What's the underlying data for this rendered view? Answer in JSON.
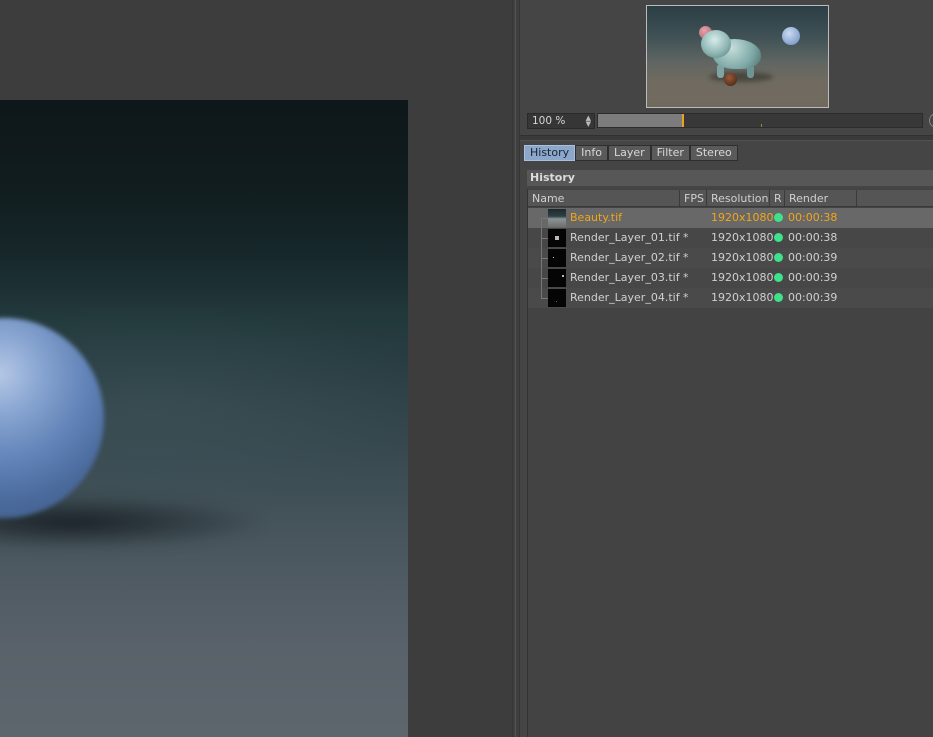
{
  "viewport": {
    "image_label": "rendered image (blue sphere, close-up)"
  },
  "navigator": {
    "thumbnail_label": "render preview thumbnail",
    "zoom_value": "100 %",
    "zoom_slider_fraction": 0.26
  },
  "tabs": [
    {
      "label": "History",
      "active": true
    },
    {
      "label": "Info",
      "active": false
    },
    {
      "label": "Layer",
      "active": false
    },
    {
      "label": "Filter",
      "active": false
    },
    {
      "label": "Stereo",
      "active": false
    }
  ],
  "history": {
    "header": "History",
    "columns": {
      "name": "Name",
      "fps": "FPS",
      "resolution": "Resolution",
      "r": "R",
      "render_time": "Render Time"
    },
    "rows": [
      {
        "name": "Beauty.tif",
        "fps": "",
        "resolution": "1920x1080",
        "status_color": "#3ee28a",
        "render_time": "00:00:38",
        "selected": true
      },
      {
        "name": "Render_Layer_01.tif *",
        "fps": "",
        "resolution": "1920x1080",
        "status_color": "#3ee28a",
        "render_time": "00:00:38",
        "selected": false
      },
      {
        "name": "Render_Layer_02.tif *",
        "fps": "",
        "resolution": "1920x1080",
        "status_color": "#3ee28a",
        "render_time": "00:00:39",
        "selected": false
      },
      {
        "name": "Render_Layer_03.tif *",
        "fps": "",
        "resolution": "1920x1080",
        "status_color": "#3ee28a",
        "render_time": "00:00:39",
        "selected": false
      },
      {
        "name": "Render_Layer_04.tif *",
        "fps": "",
        "resolution": "1920x1080",
        "status_color": "#3ee28a",
        "render_time": "00:00:39",
        "selected": false
      }
    ]
  },
  "colors": {
    "selected_text": "#f2a619",
    "active_tab": "#8ba8cc",
    "status_ok": "#3ee28a",
    "slider_handle": "#f0a020"
  }
}
